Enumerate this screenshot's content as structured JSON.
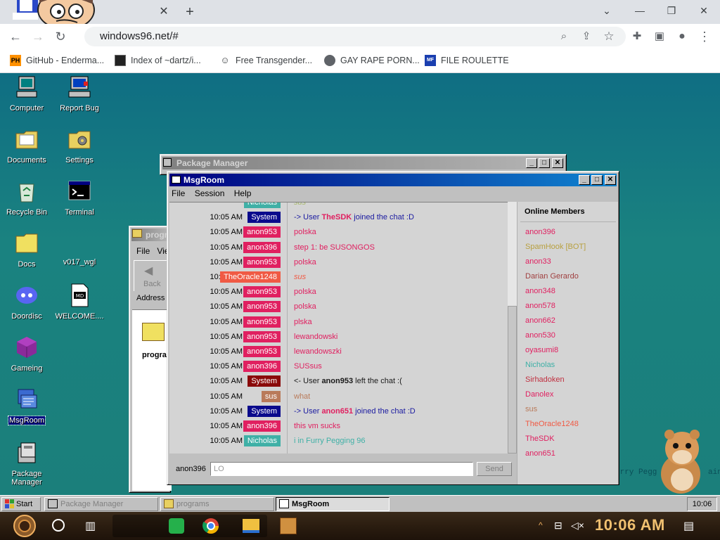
{
  "browser": {
    "url": "windows96.net/#",
    "bookmarks": [
      {
        "label": "GitHub - Enderma...",
        "icon": "ph-icon"
      },
      {
        "label": "Index of ~dartz/i...",
        "icon": "dartz-icon"
      },
      {
        "label": "Free Transgender...",
        "icon": "ghost-icon"
      },
      {
        "label": "GAY RAPE PORN...",
        "icon": "globe-icon"
      },
      {
        "label": "FILE ROULETTE",
        "icon": "mf-icon"
      }
    ]
  },
  "desktop": {
    "icons": [
      {
        "label": "Computer"
      },
      {
        "label": "Report Bug"
      },
      {
        "label": "Documents"
      },
      {
        "label": "Settings"
      },
      {
        "label": "Recycle Bin"
      },
      {
        "label": "Terminal"
      },
      {
        "label": "Docs"
      },
      {
        "label": "v017_wgl"
      },
      {
        "label": "Doordisc"
      },
      {
        "label": "WELCOME...."
      },
      {
        "label": "Gameing"
      },
      {
        "label": "MsgRoom"
      },
      {
        "label": "Package Manager"
      }
    ],
    "background_text": "urry Pegg",
    "background_text2": "ain"
  },
  "package_manager": {
    "title": "Package Manager"
  },
  "explorer": {
    "title": "progr",
    "menu": [
      "File",
      "Vie"
    ],
    "back_label": "Back",
    "address_label": "Address",
    "folder_label": "progra"
  },
  "msgroom": {
    "title": "MsgRoom",
    "menu": [
      "File",
      "Session",
      "Help"
    ],
    "messages": [
      {
        "time": "",
        "user": "Nicholas",
        "user_color": "#3fb0a6",
        "text": "sus",
        "text_color": "#a7b86a",
        "italic": true,
        "user_suffix": "",
        "text_suffix": ""
      },
      {
        "time": "10:05 AM",
        "user": "System",
        "user_color": "#0a0a8c",
        "text": "-> User ",
        "text_color": "#1a1aa0",
        "bold": "TheSDK",
        "bold_color": "#e02060",
        "after": " joined the chat :D"
      },
      {
        "time": "10:05 AM",
        "user": "anon953",
        "user_color": "#e02060",
        "text": "polska",
        "text_color": "#e02060"
      },
      {
        "time": "10:05 AM",
        "user": "anon396",
        "user_color": "#e02060",
        "text": "step 1: be SUSONGOS",
        "text_color": "#e02060"
      },
      {
        "time": "10:05 AM",
        "user": "anon953",
        "user_color": "#e02060",
        "text": "polska",
        "text_color": "#e02060"
      },
      {
        "time": "10:05 AM",
        "user": "TheOracle1248",
        "user_color": "#f05a44",
        "text": "sus",
        "text_color": "#f05a44",
        "italic": true
      },
      {
        "time": "10:05 AM",
        "user": "anon953",
        "user_color": "#e02060",
        "text": "polska",
        "text_color": "#e02060"
      },
      {
        "time": "10:05 AM",
        "user": "anon953",
        "user_color": "#e02060",
        "text": "polska",
        "text_color": "#e02060"
      },
      {
        "time": "10:05 AM",
        "user": "anon953",
        "user_color": "#e02060",
        "text": "plska",
        "text_color": "#e02060"
      },
      {
        "time": "10:05 AM",
        "user": "anon953",
        "user_color": "#e02060",
        "text": "lewandowski",
        "text_color": "#e02060"
      },
      {
        "time": "10:05 AM",
        "user": "anon953",
        "user_color": "#e02060",
        "text": "lewandowszki",
        "text_color": "#e02060"
      },
      {
        "time": "10:05 AM",
        "user": "anon396",
        "user_color": "#e02060",
        "text": "SUSsus",
        "text_color": "#e02060"
      },
      {
        "time": "10:05 AM",
        "user": "System",
        "user_color": "#8a0a0a",
        "text": "<- User ",
        "text_color": "#1a1a1a",
        "bold": "anon953",
        "bold_color": "#1a1a1a",
        "after": " left the chat :("
      },
      {
        "time": "10:05 AM",
        "user": "sus",
        "user_color": "#b97a5a",
        "text": "what",
        "text_color": "#b97a5a"
      },
      {
        "time": "10:05 AM",
        "user": "System",
        "user_color": "#0a0a8c",
        "text": "-> User ",
        "text_color": "#1a1aa0",
        "bold": "anon651",
        "bold_color": "#e02060",
        "after": " joined the chat :D"
      },
      {
        "time": "10:05 AM",
        "user": "anon396",
        "user_color": "#e02060",
        "text": "this vm sucks",
        "text_color": "#e02060"
      },
      {
        "time": "10:05 AM",
        "user": "Nicholas",
        "user_color": "#3fb0a6",
        "text": "i in Furry Pegging 96",
        "text_color": "#3fb0a6"
      }
    ],
    "members_heading": "Online Members",
    "members": [
      {
        "name": "anon396",
        "color": "#e02060"
      },
      {
        "name": "SpamHook [BOT]",
        "color": "#b8a040"
      },
      {
        "name": "anon33",
        "color": "#e02060"
      },
      {
        "name": "Darian Gerardo",
        "color": "#a04040"
      },
      {
        "name": "anon348",
        "color": "#e02060"
      },
      {
        "name": "anon578",
        "color": "#e02060"
      },
      {
        "name": "anon662",
        "color": "#e02060"
      },
      {
        "name": "anon530",
        "color": "#e02060"
      },
      {
        "name": "oyasumi8",
        "color": "#e02060"
      },
      {
        "name": "Nicholas",
        "color": "#3fb0a6"
      },
      {
        "name": "Sirhadoken",
        "color": "#c03040"
      },
      {
        "name": "Danolex",
        "color": "#e02060"
      },
      {
        "name": "sus",
        "color": "#b97a5a"
      },
      {
        "name": "TheOracle1248",
        "color": "#f05a44"
      },
      {
        "name": "TheSDK",
        "color": "#e02060"
      },
      {
        "name": "anon651",
        "color": "#e02060"
      }
    ],
    "compose_user": "anon396",
    "compose_value": "LO",
    "send_label": "Send"
  },
  "w96_taskbar": {
    "start_label": "Start",
    "tasks": [
      {
        "label": "Package Manager"
      },
      {
        "label": "programs"
      },
      {
        "label": "MsgRoom"
      }
    ],
    "clock": "10:06"
  },
  "win10_taskbar": {
    "clock": "10:06 AM"
  }
}
